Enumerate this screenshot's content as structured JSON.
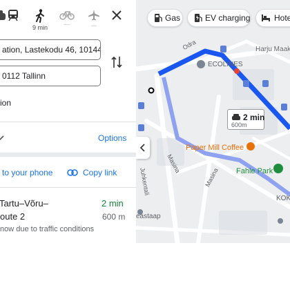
{
  "travel_modes": [
    {
      "name": "transit",
      "caption": "",
      "selected": false
    },
    {
      "name": "walking",
      "caption": "9 min",
      "selected": true
    },
    {
      "name": "cycling",
      "caption": "—",
      "selected": false
    },
    {
      "name": "flights",
      "caption": "—",
      "selected": false
    }
  ],
  "directions": {
    "origin_value": "ation, Lastekodu 46, 10144",
    "destination_value": "0112 Tallinn",
    "options_text": "ion",
    "options_link": "Options",
    "send_to_phone": "to your phone",
    "copy_link": "Copy link"
  },
  "route": {
    "name_line1": "Tartu–Võru–",
    "name_line2": "oute 2",
    "duration": "2 min",
    "distance": "600 m",
    "traffic_note": "now due to traffic conditions"
  },
  "map": {
    "chips": [
      "Gas",
      "EV charging",
      "Hotel"
    ],
    "callout_time": "2 min",
    "callout_distance": "600m",
    "places": {
      "ecolines": "ECOLINES",
      "harju": "Harju Maakohus",
      "paper_mill": "Paper Mill Coffee",
      "fahle": "Fahle Park",
      "koke": "KOK",
      "eastaap": "eastaap"
    },
    "streets": {
      "odra": "Odra",
      "masina": "Masina",
      "masina2": "Masina",
      "juhkentali": "Juhkentali"
    },
    "colors": {
      "route_primary": "#1a56f0",
      "route_alt": "#8ea2f0",
      "accent": "#1a73e8",
      "park": "#1e8e3e",
      "coffee": "#e8710a"
    }
  }
}
